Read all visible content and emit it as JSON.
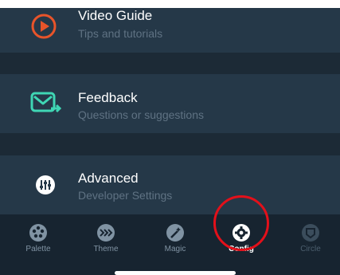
{
  "menu": {
    "video_guide": {
      "title": "Video Guide",
      "subtitle": "Tips and tutorials"
    },
    "feedback": {
      "title": "Feedback",
      "subtitle": "Questions or suggestions"
    },
    "advanced": {
      "title": "Advanced",
      "subtitle": "Developer Settings"
    }
  },
  "tabs": [
    {
      "label": "Palette",
      "icon": "palette-icon"
    },
    {
      "label": "Theme",
      "icon": "theme-icon"
    },
    {
      "label": "Magic",
      "icon": "magic-wand-icon"
    },
    {
      "label": "Config",
      "icon": "gear-icon",
      "active": true
    },
    {
      "label": "Circle",
      "icon": "circle-icon"
    }
  ],
  "colors": {
    "background": "#1e2e3b",
    "row": "#253848",
    "accent_orange": "#e8542a",
    "accent_teal": "#3fd6b4",
    "highlight_red": "#e3101a"
  }
}
